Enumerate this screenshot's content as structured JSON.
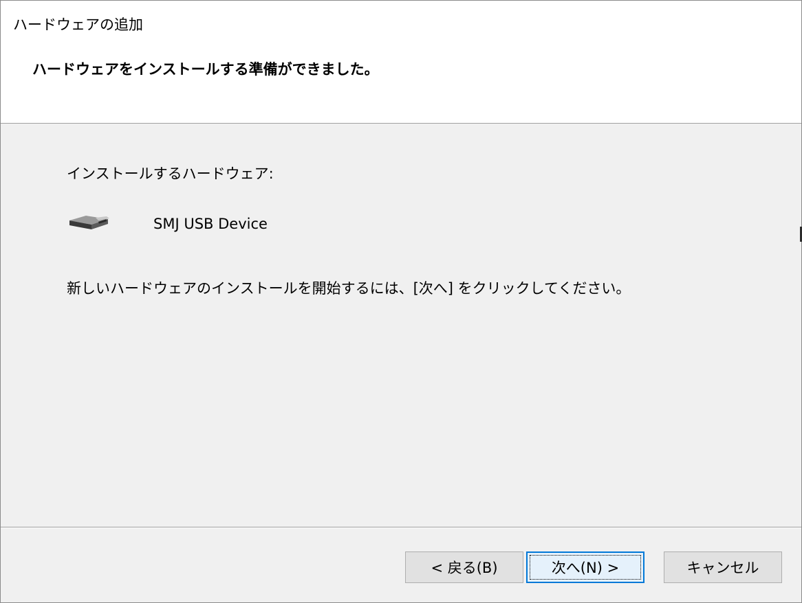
{
  "window": {
    "title": "ハードウェアの追加",
    "heading": "ハードウェアをインストールする準備ができました。"
  },
  "content": {
    "hardware_label": "インストールするハードウェア:",
    "device_icon": "usb-device-icon",
    "device_name": "SMJ USB Device",
    "instruction": "新しいハードウェアのインストールを開始するには、[次へ] をクリックしてください。"
  },
  "buttons": {
    "back": "< 戻る(B)",
    "next": "次へ(N) >",
    "cancel": "キャンセル"
  },
  "colors": {
    "focus_border": "#0078d7",
    "dialog_bg": "#f0f0f0",
    "header_bg": "#ffffff"
  }
}
